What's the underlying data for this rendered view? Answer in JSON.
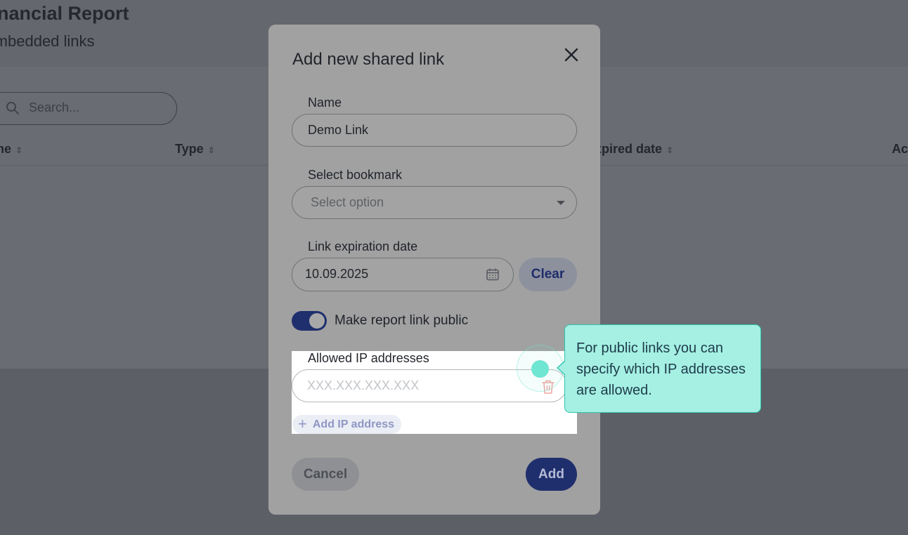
{
  "background": {
    "title": "Financial Report",
    "subtitle": "Embedded links",
    "search_placeholder": "Search...",
    "columns": [
      "Name",
      "Type",
      "Expired date",
      "Actions"
    ]
  },
  "modal": {
    "title": "Add new shared link",
    "name_label": "Name",
    "name_value": "Demo Link",
    "bookmark_label": "Select bookmark",
    "bookmark_placeholder": "Select option",
    "expiration_label": "Link expiration date",
    "expiration_value": "10.09.2025",
    "clear_label": "Clear",
    "public_toggle_label": "Make report link public",
    "public_toggle_on": true,
    "ip_label": "Allowed IP addresses",
    "ip_placeholder": "XXX.XXX.XXX.XXX",
    "add_ip_label": "Add IP address",
    "cancel_label": "Cancel",
    "add_label": "Add"
  },
  "tooltip": {
    "text": "For public links you can specify which IP addresses are allowed."
  },
  "colors": {
    "primary": "#1f2f6d",
    "tooltip_bg": "#a5f0e3",
    "tooltip_border": "#2fc4ac",
    "hotspot": "#6fe6d2"
  },
  "icons": [
    "search-icon",
    "close-icon",
    "calendar-icon",
    "trash-icon",
    "plus-icon",
    "sort-icon",
    "chevron-down-icon"
  ]
}
